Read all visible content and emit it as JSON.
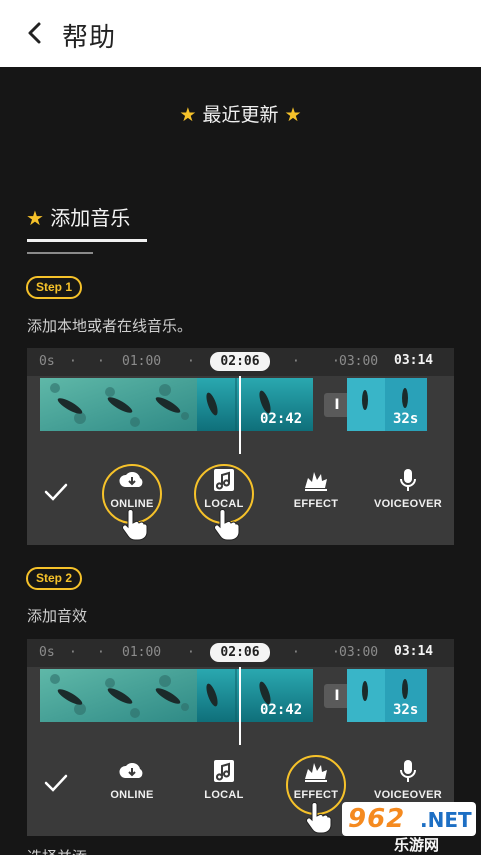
{
  "header": {
    "title": "帮助",
    "back_icon": "chevron-left-icon"
  },
  "recent": {
    "label": "最近更新",
    "icon": "star-icon"
  },
  "section": {
    "title": "添加音乐",
    "icon": "star-icon"
  },
  "steps": [
    {
      "badge": "Step 1",
      "desc": "添加本地或者在线音乐。",
      "timeline": {
        "start": "0s",
        "mark1": "01:00",
        "current": "02:06",
        "mark2": "03:00",
        "end": "03:14"
      },
      "clip_time": "02:42",
      "clip2_time": "32s",
      "split_label": "I",
      "tools": [
        "ONLINE",
        "LOCAL",
        "EFFECT",
        "VOICEOVER"
      ],
      "highlighted": [
        "ONLINE",
        "LOCAL"
      ]
    },
    {
      "badge": "Step 2",
      "desc": "添加音效",
      "timeline": {
        "start": "0s",
        "mark1": "01:00",
        "current": "02:06",
        "mark2": "03:00",
        "end": "03:14"
      },
      "clip_time": "02:42",
      "clip2_time": "32s",
      "split_label": "I",
      "tools": [
        "ONLINE",
        "LOCAL",
        "EFFECT",
        "VOICEOVER"
      ],
      "highlighted": [
        "EFFECT"
      ]
    }
  ],
  "cut_text": "选择并添",
  "watermark": {
    "number": "962",
    "domain": ".NET",
    "sub": "乐游网"
  },
  "colors": {
    "accent": "#f6c22a",
    "background": "#161616",
    "panel": "#3a3a3a"
  }
}
